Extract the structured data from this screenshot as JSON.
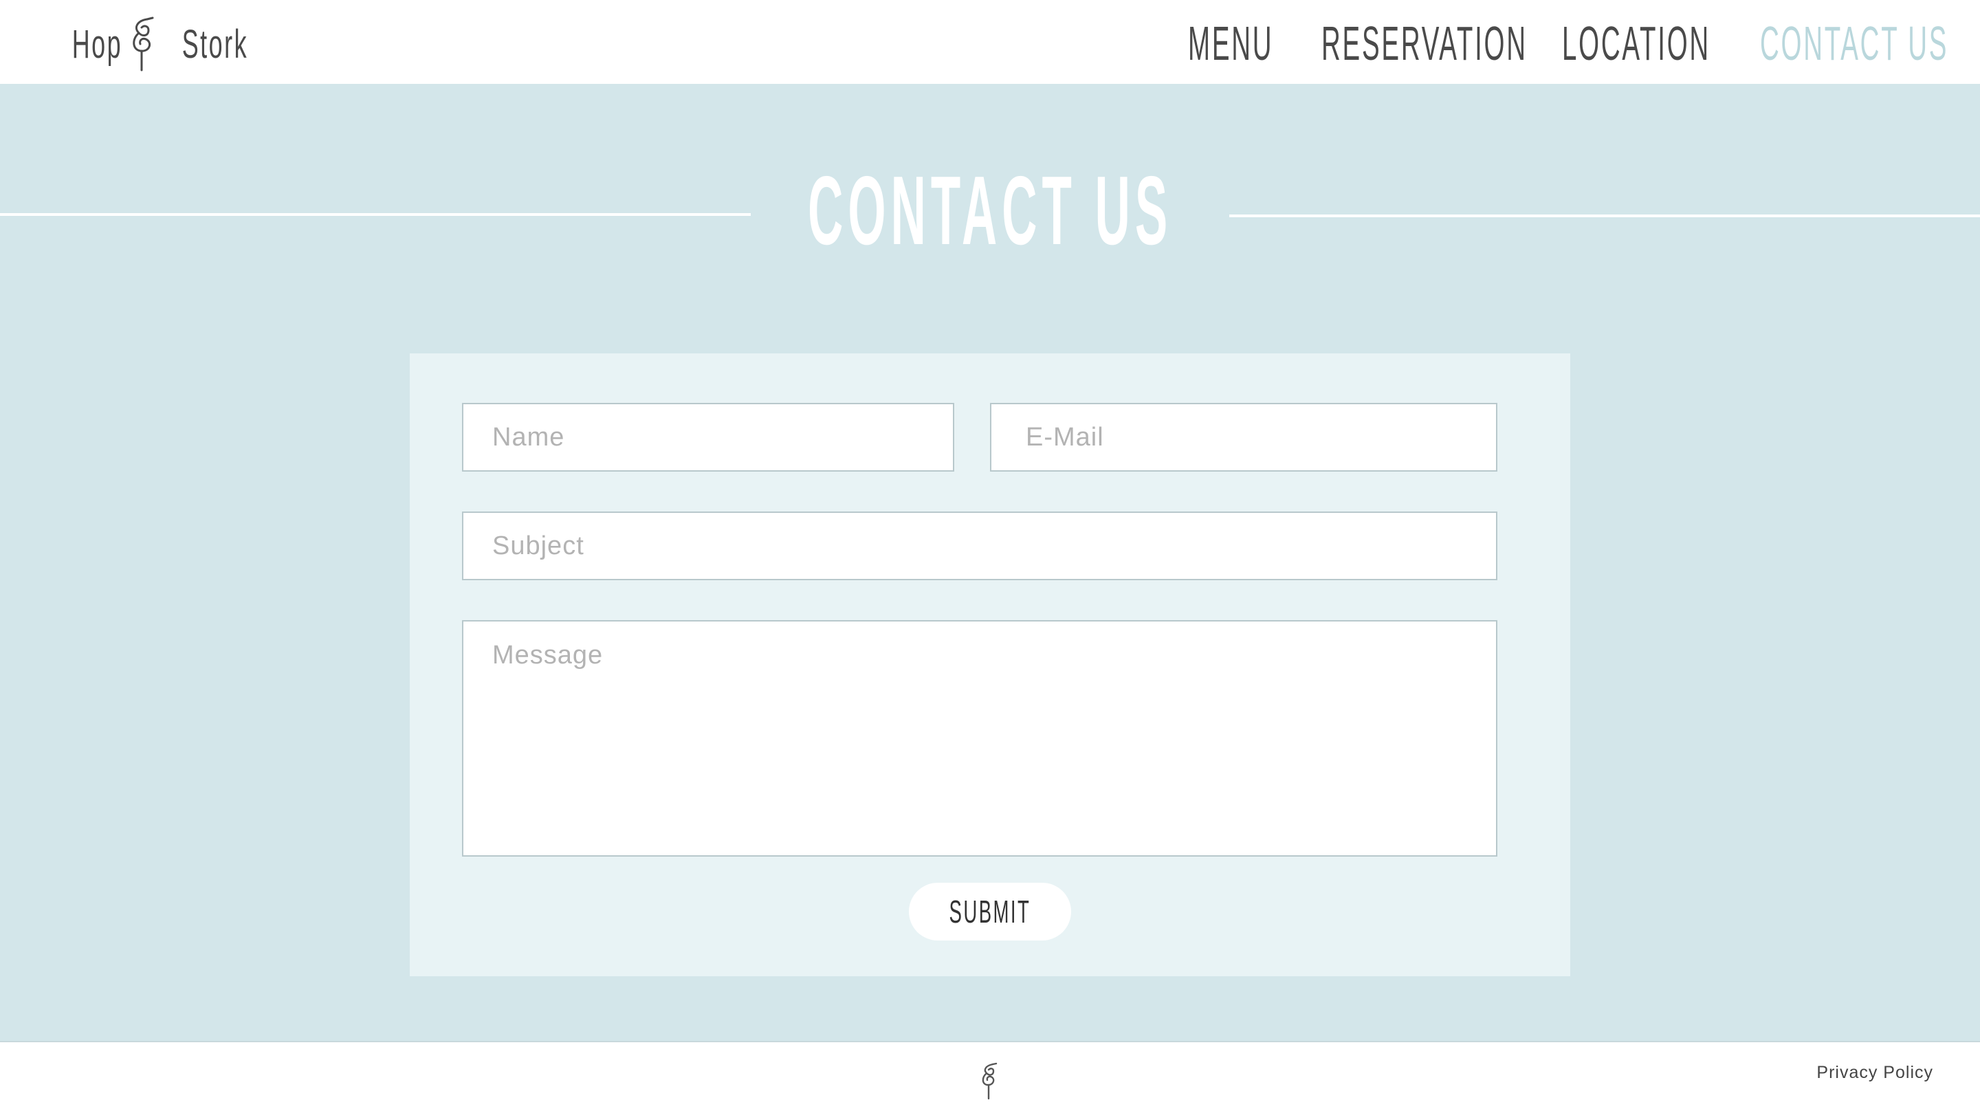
{
  "brand": {
    "word_left": "Hop",
    "word_right": "Stork",
    "mark_icon": "stork-icon"
  },
  "nav": {
    "items": [
      {
        "label": "Menu",
        "active": false
      },
      {
        "label": "Reservation",
        "active": false
      },
      {
        "label": "Location",
        "active": false
      },
      {
        "label": "Contact Us",
        "active": true
      }
    ]
  },
  "page": {
    "title": "Contact Us"
  },
  "form": {
    "name_placeholder": "Name",
    "email_placeholder": "E-Mail",
    "subject_placeholder": "Subject",
    "message_placeholder": "Message",
    "submit_label": "Submit"
  },
  "footer": {
    "mark_icon": "stork-icon",
    "privacy_label": "Privacy Policy"
  },
  "colors": {
    "main_background": "#d3e6ea",
    "card_background": "#e8f3f5",
    "active_nav": "#b9d7dc",
    "text": "#4a4a4a"
  }
}
